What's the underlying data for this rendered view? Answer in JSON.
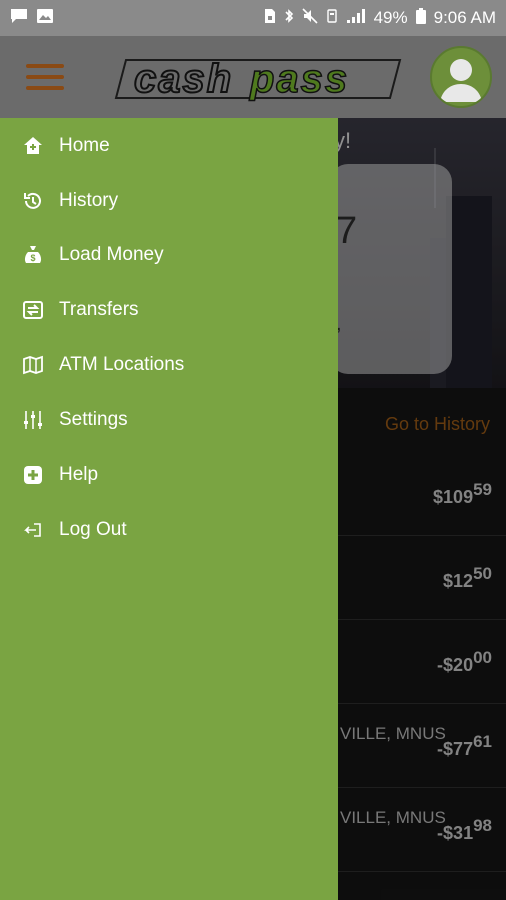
{
  "status_bar": {
    "battery": "49%",
    "time": "9:06 AM",
    "icons": [
      "chat-icon",
      "image-icon",
      "sim-lock-icon",
      "bluetooth-icon",
      "mute-icon",
      "data-icon",
      "signal-icon",
      "battery-icon"
    ]
  },
  "header": {
    "logo_text": "cashpass",
    "icons": [
      "hamburger-menu-icon",
      "user-avatar-icon"
    ]
  },
  "drawer": {
    "items": [
      {
        "label": "Home",
        "icon": "home-icon"
      },
      {
        "label": "History",
        "icon": "history-icon"
      },
      {
        "label": "Load Money",
        "icon": "money-bag-icon"
      },
      {
        "label": "Transfers",
        "icon": "transfer-icon"
      },
      {
        "label": "ATM Locations",
        "icon": "map-icon"
      },
      {
        "label": "Settings",
        "icon": "sliders-icon"
      },
      {
        "label": "Help",
        "icon": "help-icon"
      },
      {
        "label": "Log Out",
        "icon": "logout-icon"
      }
    ]
  },
  "main": {
    "hero_fragment": "y!",
    "card_glyph": "7",
    "card_glyph_small": ",",
    "goto_history": "Go to History",
    "transactions": [
      {
        "desc": "",
        "amount_main": "$109",
        "amount_cents": "59"
      },
      {
        "desc": "",
        "amount_main": "$12",
        "amount_cents": "50"
      },
      {
        "desc": "",
        "amount_main": "-$20",
        "amount_cents": "00"
      },
      {
        "desc": "VILLE, MNUS",
        "amount_main": "-$77",
        "amount_cents": "61"
      },
      {
        "desc": "VILLE, MNUS",
        "amount_main": "-$31",
        "amount_cents": "98"
      }
    ]
  },
  "colors": {
    "drawer": "#7aa442",
    "accent_orange": "#9a5a16",
    "logo_green": "#4f7a1e"
  }
}
